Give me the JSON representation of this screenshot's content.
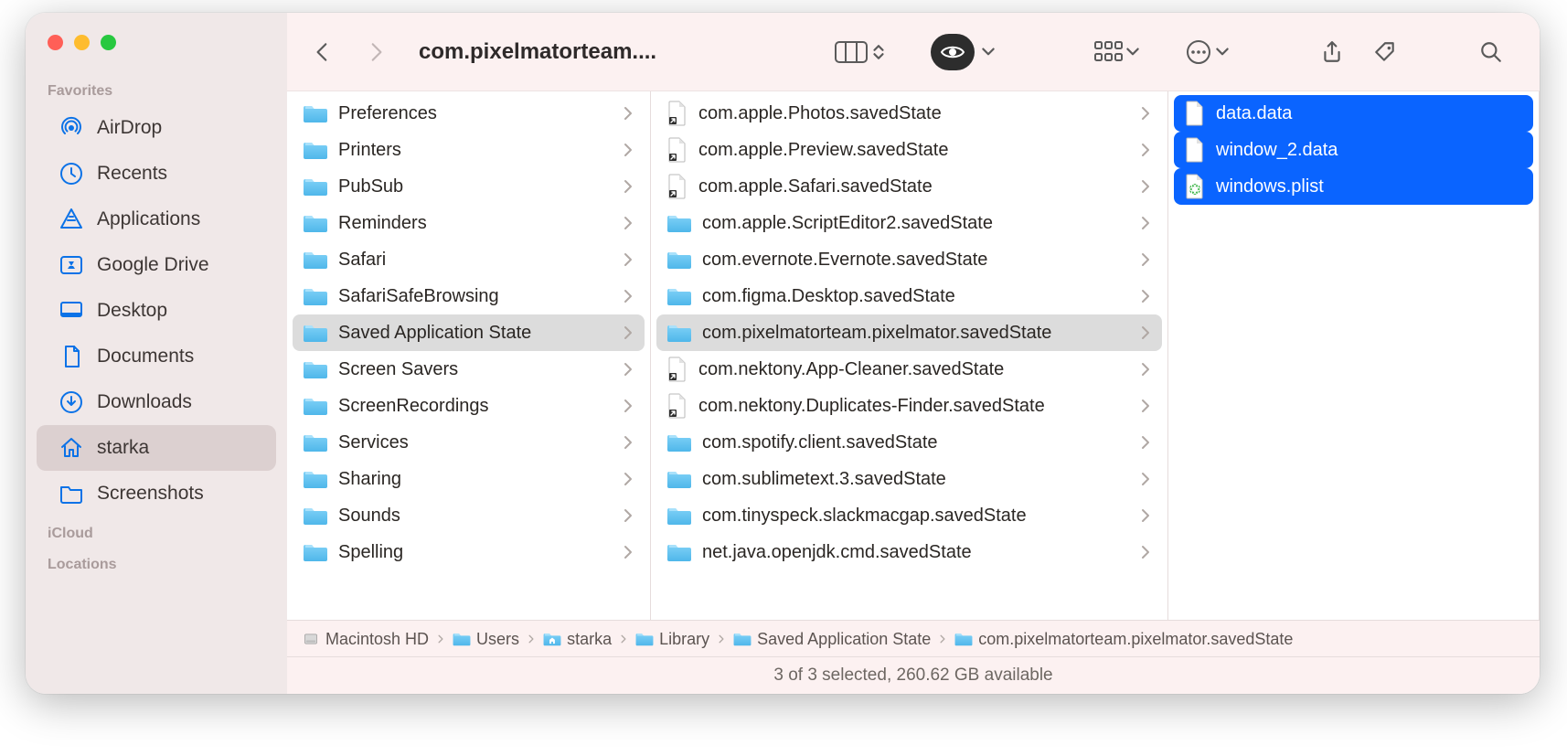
{
  "window_title": "com.pixelmatorteam....",
  "sidebar": {
    "sections": [
      "Favorites",
      "iCloud",
      "Locations"
    ],
    "favorites": [
      {
        "icon": "airdrop",
        "label": "AirDrop"
      },
      {
        "icon": "clock",
        "label": "Recents"
      },
      {
        "icon": "apps",
        "label": "Applications"
      },
      {
        "icon": "drive",
        "label": "Google Drive"
      },
      {
        "icon": "desktop",
        "label": "Desktop"
      },
      {
        "icon": "doc",
        "label": "Documents"
      },
      {
        "icon": "download",
        "label": "Downloads"
      },
      {
        "icon": "home",
        "label": "starka",
        "active": true
      },
      {
        "icon": "folder",
        "label": "Screenshots"
      }
    ]
  },
  "column1": [
    {
      "label": "Preferences",
      "type": "folder"
    },
    {
      "label": "Printers",
      "type": "folder"
    },
    {
      "label": "PubSub",
      "type": "folder"
    },
    {
      "label": "Reminders",
      "type": "folder"
    },
    {
      "label": "Safari",
      "type": "folder"
    },
    {
      "label": "SafariSafeBrowsing",
      "type": "folder"
    },
    {
      "label": "Saved Application State",
      "type": "folder",
      "selected": true
    },
    {
      "label": "Screen Savers",
      "type": "folder"
    },
    {
      "label": "ScreenRecordings",
      "type": "folder"
    },
    {
      "label": "Services",
      "type": "folder"
    },
    {
      "label": "Sharing",
      "type": "folder"
    },
    {
      "label": "Sounds",
      "type": "folder"
    },
    {
      "label": "Spelling",
      "type": "folder"
    }
  ],
  "column2": [
    {
      "label": "com.apple.Photos.savedState",
      "type": "alias"
    },
    {
      "label": "com.apple.Preview.savedState",
      "type": "alias"
    },
    {
      "label": "com.apple.Safari.savedState",
      "type": "alias"
    },
    {
      "label": "com.apple.ScriptEditor2.savedState",
      "type": "folder"
    },
    {
      "label": "com.evernote.Evernote.savedState",
      "type": "folder"
    },
    {
      "label": "com.figma.Desktop.savedState",
      "type": "folder"
    },
    {
      "label": "com.pixelmatorteam.pixelmator.savedState",
      "type": "folder",
      "selected": true
    },
    {
      "label": "com.nektony.App-Cleaner.savedState",
      "type": "alias"
    },
    {
      "label": "com.nektony.Duplicates-Finder.savedState",
      "type": "alias"
    },
    {
      "label": "com.spotify.client.savedState",
      "type": "folder"
    },
    {
      "label": "com.sublimetext.3.savedState",
      "type": "folder"
    },
    {
      "label": "com.tinyspeck.slackmacgap.savedState",
      "type": "folder"
    },
    {
      "label": "net.java.openjdk.cmd.savedState",
      "type": "folder"
    }
  ],
  "column3": [
    {
      "label": "data.data",
      "type": "file",
      "selected": true
    },
    {
      "label": "window_2.data",
      "type": "file",
      "selected": true
    },
    {
      "label": "windows.plist",
      "type": "plist",
      "selected": true
    }
  ],
  "pathbar": [
    "Macintosh HD",
    "Users",
    "starka",
    "Library",
    "Saved Application State",
    "com.pixelmatorteam.pixelmator.savedState"
  ],
  "status": "3 of 3 selected, 260.62 GB available"
}
